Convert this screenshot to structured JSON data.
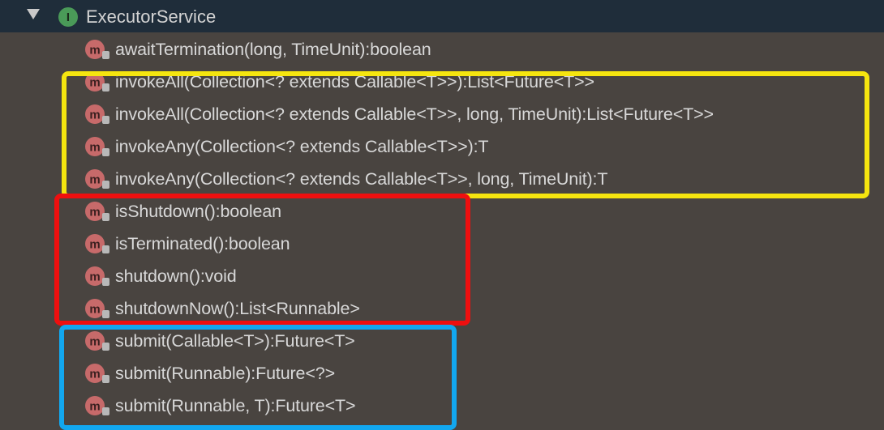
{
  "header": {
    "title": "ExecutorService",
    "icon": "interface-icon",
    "icon_letter": "I",
    "expanded": true
  },
  "methods": [
    {
      "label": "awaitTermination(long, TimeUnit):boolean",
      "icon": "method-icon",
      "icon_letter": "m"
    },
    {
      "label": "invokeAll(Collection<? extends Callable<T>>):List<Future<T>>",
      "icon": "method-icon",
      "icon_letter": "m"
    },
    {
      "label": "invokeAll(Collection<? extends Callable<T>>, long, TimeUnit):List<Future<T>>",
      "icon": "method-icon",
      "icon_letter": "m"
    },
    {
      "label": "invokeAny(Collection<? extends Callable<T>>):T",
      "icon": "method-icon",
      "icon_letter": "m"
    },
    {
      "label": "invokeAny(Collection<? extends Callable<T>>, long, TimeUnit):T",
      "icon": "method-icon",
      "icon_letter": "m"
    },
    {
      "label": "isShutdown():boolean",
      "icon": "method-icon",
      "icon_letter": "m"
    },
    {
      "label": "isTerminated():boolean",
      "icon": "method-icon",
      "icon_letter": "m"
    },
    {
      "label": "shutdown():void",
      "icon": "method-icon",
      "icon_letter": "m"
    },
    {
      "label": "shutdownNow():List<Runnable>",
      "icon": "method-icon",
      "icon_letter": "m"
    },
    {
      "label": "submit(Callable<T>):Future<T>",
      "icon": "method-icon",
      "icon_letter": "m"
    },
    {
      "label": "submit(Runnable):Future<?>",
      "icon": "method-icon",
      "icon_letter": "m"
    },
    {
      "label": "submit(Runnable, T):Future<T>",
      "icon": "method-icon",
      "icon_letter": "m"
    }
  ],
  "highlight_colors": {
    "yellow": "#f5e50f",
    "red": "#ee0f0f",
    "blue": "#12a7ef"
  },
  "colors": {
    "background": "#494440",
    "header_background": "#1f2d3a",
    "text": "#d8d8d8",
    "interface_icon": "#4a9a58",
    "method_icon": "#c76a6a"
  }
}
